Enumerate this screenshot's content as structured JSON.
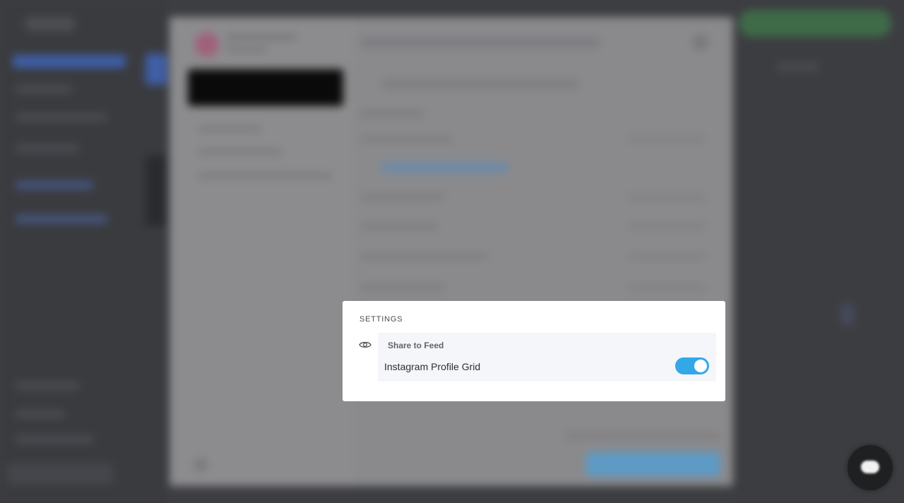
{
  "settings": {
    "title": "SETTINGS",
    "section_label": "Share to Feed",
    "toggle_label": "Instagram Profile Grid",
    "toggle_on": true,
    "accent_color": "#32a8e8",
    "icon": "eye-icon"
  },
  "chat": {
    "icon": "chat-icon"
  }
}
